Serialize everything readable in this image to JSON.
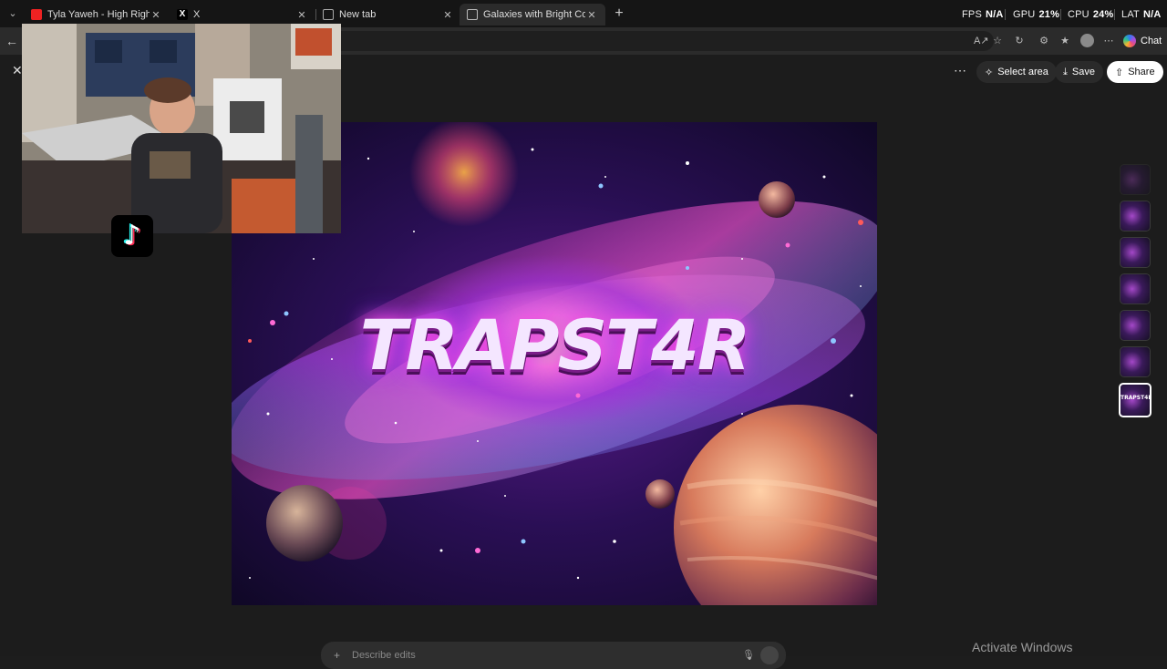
{
  "tabs": [
    {
      "title": "Tyla Yaweh - High Right Now (Ren",
      "favicon": "youtube-icon"
    },
    {
      "title": "X",
      "favicon": "x-icon"
    },
    {
      "title": "New tab",
      "favicon": "newtab-icon"
    },
    {
      "title": "Galaxies with Bright Colors",
      "favicon": "copilot-icon",
      "active": true
    }
  ],
  "new_tab_label": "+",
  "hud": {
    "fps_label": "FPS",
    "fps_value": "N/A",
    "gpu_label": "GPU",
    "gpu_value": "21%",
    "cpu_label": "CPU",
    "cpu_value": "24%",
    "lat_label": "LAT",
    "lat_value": "N/A"
  },
  "toolbar": {
    "chat_label": "Chat"
  },
  "viewer": {
    "select_area_label": "Select area",
    "save_label": "Save",
    "share_label": "Share"
  },
  "artwork": {
    "title_text": "TRAPST4R"
  },
  "thumbnails": [
    {
      "label": ""
    },
    {
      "label": ""
    },
    {
      "label": ""
    },
    {
      "label": ""
    },
    {
      "label": ""
    },
    {
      "label": ""
    },
    {
      "label": "TRAPST4R",
      "selected": true
    }
  ],
  "composer": {
    "placeholder": "Describe edits"
  },
  "watermark": "Activate Windows",
  "colors": {
    "accent": "#ffffff",
    "background": "#1c1c1c",
    "youtube": "#e22222"
  }
}
